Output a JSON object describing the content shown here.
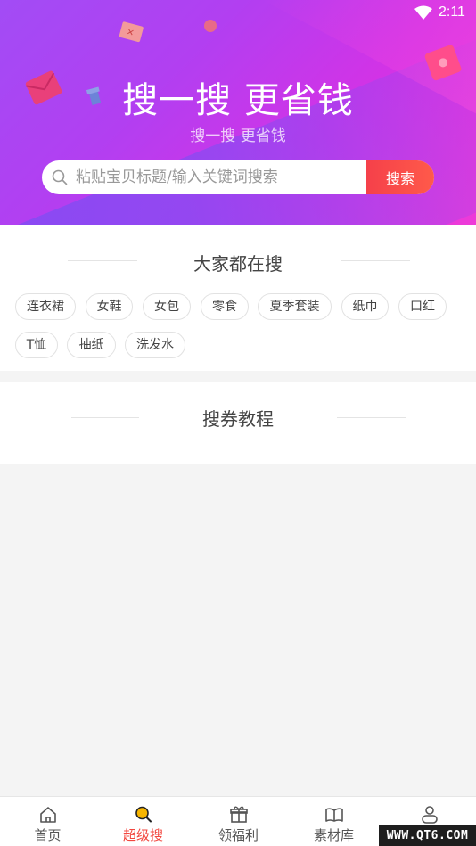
{
  "status_bar": {
    "time": "2:11",
    "wifi_icon": "wifi-icon"
  },
  "header": {
    "headline": "搜一搜 更省钱",
    "subhead": "搜一搜 更省钱",
    "colors": {
      "gradient_start": "#a24cf5",
      "gradient_end": "#ee3ad8"
    }
  },
  "search": {
    "placeholder": "粘贴宝贝标题/输入关键词搜索",
    "value": "",
    "button_label": "搜索",
    "icon": "search-icon",
    "button_color": "#f5404a"
  },
  "hot_search": {
    "title": "大家都在搜",
    "tags": [
      "连衣裙",
      "女鞋",
      "女包",
      "零食",
      "夏季套装",
      "纸巾",
      "口红",
      "T恤",
      "抽纸",
      "洗发水"
    ]
  },
  "tutorial": {
    "title": "搜券教程"
  },
  "bottom_nav": {
    "items": [
      {
        "label": "首页",
        "icon": "home-icon",
        "active": false
      },
      {
        "label": "超级搜",
        "icon": "search-icon",
        "active": true
      },
      {
        "label": "领福利",
        "icon": "gift-icon",
        "active": false
      },
      {
        "label": "素材库",
        "icon": "book-icon",
        "active": false
      },
      {
        "label": "",
        "icon": "user-icon",
        "active": false
      }
    ],
    "active_color": "#f2473f"
  },
  "watermark": {
    "text": "WWW.QT6.COM"
  }
}
